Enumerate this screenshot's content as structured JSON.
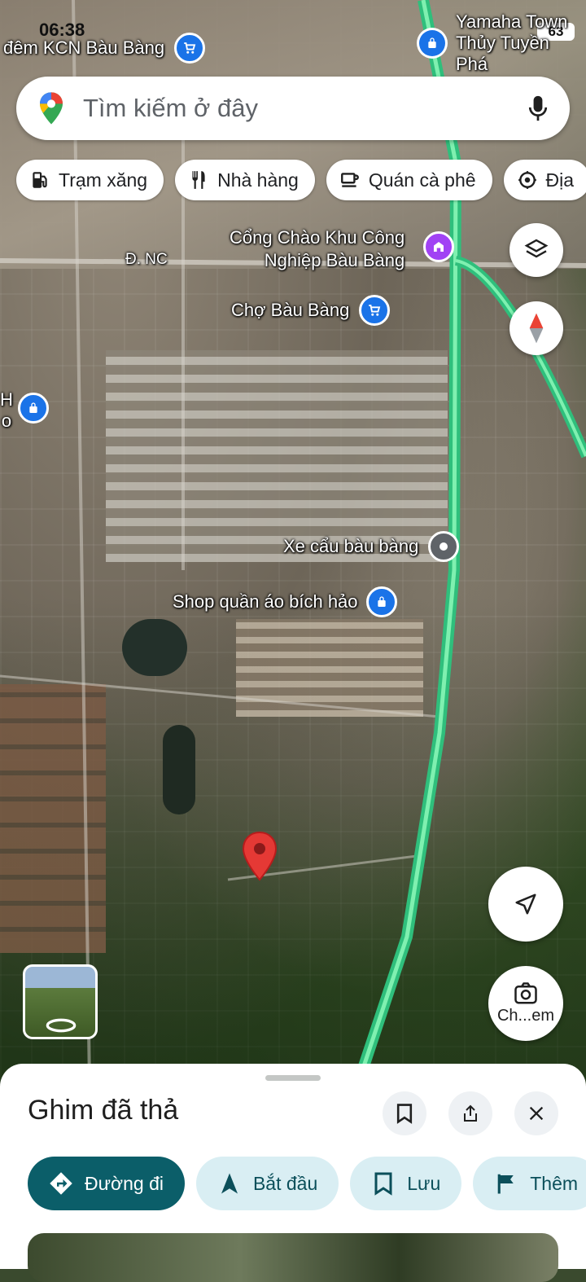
{
  "status": {
    "time": "06:38",
    "battery": "63"
  },
  "search": {
    "placeholder": "Tìm kiếm ở đây"
  },
  "chips": [
    {
      "label": "Trạm xăng",
      "icon": "gas-station-icon"
    },
    {
      "label": "Nhà hàng",
      "icon": "restaurant-icon"
    },
    {
      "label": "Quán cà phê",
      "icon": "coffee-icon"
    },
    {
      "label": "Địa",
      "icon": "attraction-icon"
    }
  ],
  "map": {
    "labels": {
      "kcn": "đêm KCN Bàu Bàng",
      "yamaha_1": "Yamaha Town",
      "yamaha_2": "Thủy Tuyền Phá",
      "road": "Đ. NC",
      "gate_1": "Cổng Chào Khu Công",
      "gate_2": "Nghiệp Bàu Bàng",
      "market": "Chợ Bàu Bàng",
      "crane": "Xe cẩu bàu bàng",
      "shop": "Shop quần áo bích hảo",
      "edge_h": "H",
      "edge_o": "o"
    }
  },
  "streetview_button_label": "Ch...em",
  "sheet": {
    "title": "Ghim đã thả",
    "actions": [
      {
        "label": "Đường đi",
        "icon": "directions-icon"
      },
      {
        "label": "Bắt đầu",
        "icon": "navigation-arrow-icon"
      },
      {
        "label": "Lưu",
        "icon": "bookmark-icon"
      },
      {
        "label": "Thêm",
        "icon": "flag-icon"
      }
    ]
  },
  "colors": {
    "primary": "#0b5e69",
    "secondary_bg": "#d9eef3",
    "route": "#3ddc84",
    "pin": "#e53935"
  }
}
